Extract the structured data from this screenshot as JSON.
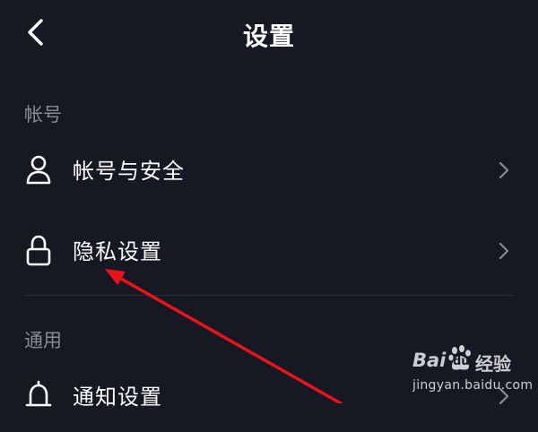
{
  "header": {
    "title": "设置",
    "back_icon": "chevron-left-icon"
  },
  "sections": [
    {
      "label": "帐号",
      "items": [
        {
          "label": "帐号与安全",
          "icon": "user-icon"
        },
        {
          "label": "隐私设置",
          "icon": "lock-icon"
        }
      ]
    },
    {
      "label": "通用",
      "items": [
        {
          "label": "通知设置",
          "icon": "bell-icon"
        }
      ]
    }
  ],
  "annotation": {
    "color": "#e8141a",
    "type": "arrow"
  },
  "watermark": {
    "brand_left": "Bai",
    "brand_du": "du",
    "brand_right": "经验",
    "url": "jingyan.baidu.com"
  },
  "colors": {
    "background": "#161823",
    "text": "#ffffff",
    "section_label": "#8a8b91",
    "chevron": "#8a8b91",
    "divider": "#2a2c37"
  }
}
